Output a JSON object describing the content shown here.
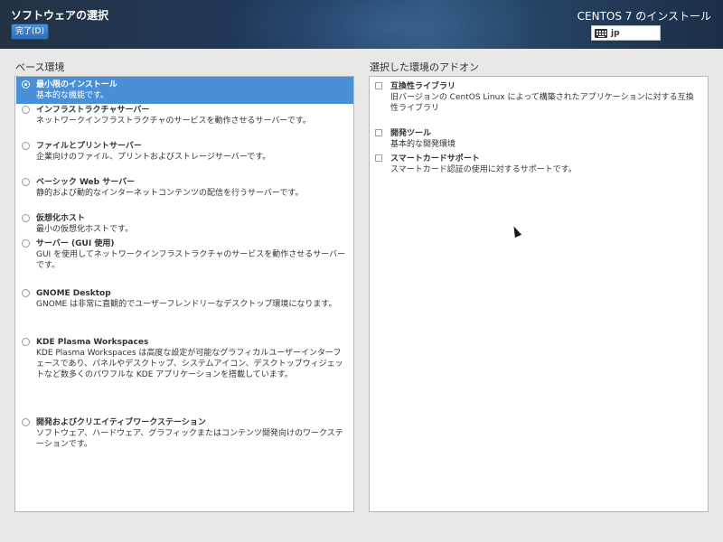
{
  "header": {
    "title": "ソフトウェアの選択",
    "done_label": "完了(D)",
    "product_title": "CENTOS 7 のインストール",
    "keyboard": {
      "icon": "keyboard-icon",
      "layout": "jp"
    }
  },
  "base_environment": {
    "label": "ベース環境",
    "selected_index": 0,
    "items": [
      {
        "name": "最小限のインストール",
        "desc": "基本的な機能です。",
        "selected": true
      },
      {
        "name": "インフラストラクチャサーバー",
        "desc": "ネットワークインフラストラクチャのサービスを動作させるサーバーです。",
        "selected": false
      },
      {
        "name": "ファイルとプリントサーバー",
        "desc": "企業向けのファイル、プリントおよびストレージサーバーです。",
        "selected": false
      },
      {
        "name": "ベーシック Web サーバー",
        "desc": "静的および動的なインターネットコンテンツの配信を行うサーバーです。",
        "selected": false
      },
      {
        "name": "仮想化ホスト",
        "desc": "最小の仮想化ホストです。",
        "selected": false
      },
      {
        "name": "サーバー (GUI 使用)",
        "desc": "GUI を使用してネットワークインフラストラクチャのサービスを動作させるサーバーです。",
        "selected": false
      },
      {
        "name": "GNOME Desktop",
        "desc": "GNOME は非常に直観的でユーザーフレンドリーなデスクトップ環境になります。",
        "selected": false
      },
      {
        "name": "KDE Plasma Workspaces",
        "desc": "KDE Plasma Workspaces は高度な設定が可能なグラフィカルユーザーインターフェースであり、パネルやデスクトップ、システムアイコン、デスクトップウィジェットなど数多くのパワフルな KDE アプリケーションを搭載しています。",
        "selected": false
      },
      {
        "name": "開発およびクリエイティブワークステーション",
        "desc": "ソフトウェア、ハードウェア、グラフィックまたはコンテンツ開発向けのワークステーションです。",
        "selected": false
      }
    ]
  },
  "addons": {
    "label": "選択した環境のアドオン",
    "items": [
      {
        "name": "互換性ライブラリ",
        "desc": "旧バージョンの CentOS Linux によって構築されたアプリケーションに対する互換性ライブラリ",
        "checked": false
      },
      {
        "name": "開発ツール",
        "desc": "基本的な開発環境",
        "checked": false
      },
      {
        "name": "スマートカードサポート",
        "desc": "スマートカード認証の使用に対するサポートです。",
        "checked": false
      }
    ]
  }
}
